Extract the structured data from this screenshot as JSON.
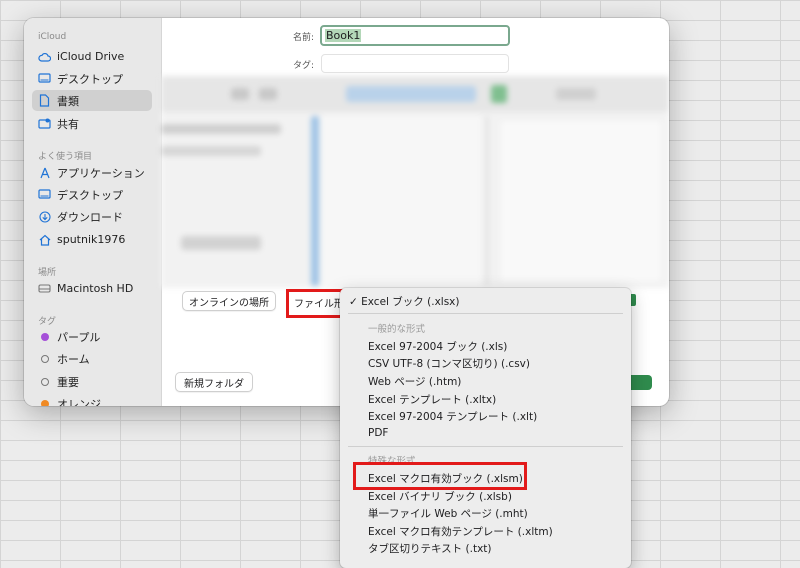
{
  "sidebar": {
    "section_icloud": "iCloud",
    "icloud_drive": "iCloud Drive",
    "desktop": "デスクトップ",
    "documents": "書類",
    "shared": "共有",
    "section_favorites": "よく使う項目",
    "applications": "アプリケーション",
    "desktop2": "デスクトップ",
    "downloads": "ダウンロード",
    "home_user": "sputnik1976",
    "section_locations": "場所",
    "macintosh_hd": "Macintosh HD",
    "section_tags": "タグ",
    "tags": [
      {
        "label": "パープル",
        "color": "#a550d8"
      },
      {
        "label": "ホーム",
        "color": ""
      },
      {
        "label": "重要",
        "color": ""
      },
      {
        "label": "オレンジ",
        "color": "#f08a24"
      }
    ]
  },
  "form": {
    "name_label": "名前:",
    "name_value": "Book1",
    "tag_label": "タグ:"
  },
  "buttons": {
    "online_locations": "オンラインの場所",
    "file_format_label": "ファイル形",
    "new_folder": "新規フォルダ"
  },
  "format_menu": {
    "selected": "Excel ブック (.xlsx)",
    "group_common": "一般的な形式",
    "common": [
      "Excel 97-2004 ブック (.xls)",
      "CSV UTF-8 (コンマ区切り) (.csv)",
      "Web ページ (.htm)",
      "Excel テンプレート (.xltx)",
      "Excel 97-2004 テンプレート (.xlt)",
      "PDF"
    ],
    "group_special": "特殊な形式",
    "special": [
      "Excel マクロ有効ブック (.xlsm)",
      "Excel バイナリ ブック (.xlsb)",
      "単一ファイル Web ページ (.mht)",
      "Excel マクロ有効テンプレート (.xltm)",
      "タブ区切りテキスト (.txt)"
    ]
  },
  "colors": {
    "accent_green": "#2f8b4d",
    "highlight_red": "#e21a1a"
  }
}
